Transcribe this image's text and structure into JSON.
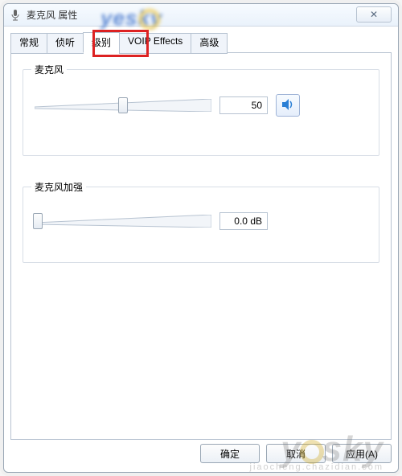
{
  "window": {
    "title": "麦克风 属性"
  },
  "tabs": [
    {
      "label": "常规"
    },
    {
      "label": "侦听"
    },
    {
      "label": "级别",
      "active": true,
      "highlighted": true
    },
    {
      "label": "VOIP Effects"
    },
    {
      "label": "高级"
    }
  ],
  "sliders": {
    "mic": {
      "label": "麦克风",
      "value_text": "50",
      "percent": 50
    },
    "boost": {
      "label": "麦克风加强",
      "value_text": "0.0 dB",
      "percent": 0
    }
  },
  "buttons": {
    "ok": "确定",
    "cancel": "取消",
    "apply": "应用(A)"
  },
  "icons": {
    "mic": "microphone-icon",
    "close": "✕",
    "speaker": "speaker-icon"
  },
  "watermark": {
    "top": "yesky",
    "bottom_main": "yesky",
    "bottom_sub": "jiaocheng.chazidian.com"
  }
}
